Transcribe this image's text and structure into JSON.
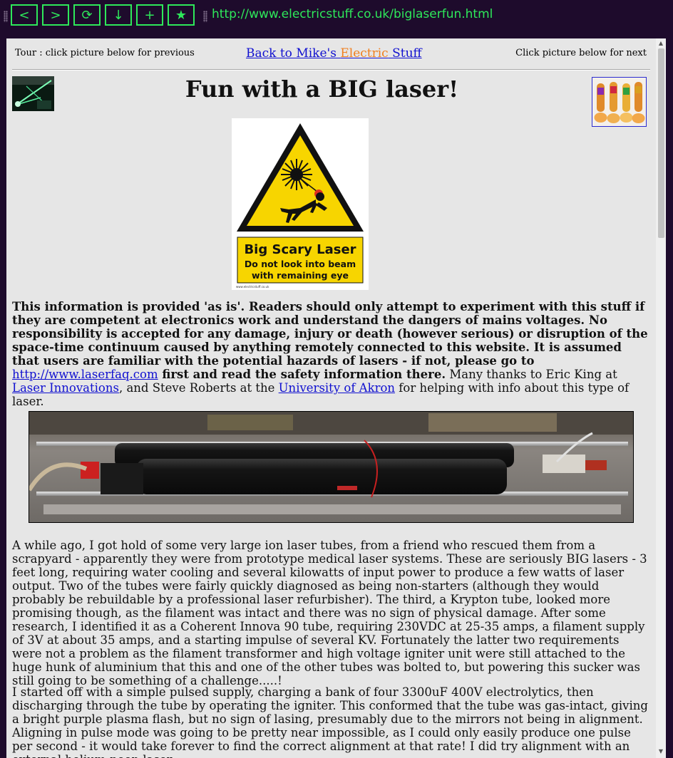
{
  "browser": {
    "nav_buttons": {
      "back": "<",
      "forward": ">",
      "reload": "⟳",
      "download": "↓",
      "new_tab": "+",
      "bookmark": "★"
    },
    "url": "http://www.electricstuff.co.uk/biglaserfun.html"
  },
  "page": {
    "tour_prev": "Tour : click picture below for previous",
    "back_link": {
      "part1": "Back to Mike's ",
      "part2": "Electric",
      "part3": " Stuff"
    },
    "tour_next": "Click picture below for next",
    "title": "Fun with a BIG laser!",
    "sign": {
      "line1": "Big Scary Laser",
      "line2": "Do not look into beam",
      "line3": "with remaining eye",
      "small": "www.electricstuff.co.uk"
    },
    "disclaimer": {
      "bold": "This information is provided 'as is'. Readers should only attempt to experiment with this stuff if they are competent at electronics work and understand the dangers of mains voltages. No responsibility is accepted for any damage, injury or death (however serious) or disruption of the space-time continuum caused by anything remotely connected to this website. It is assumed that users are familiar with the potential hazards of lasers - if not, please go to ",
      "laserfaq_link": "http://www.laserfaq.com",
      "bold2": " first and read the safety information there.",
      "thanks1": " Many thanks to Eric King at ",
      "laser_innovations_link": "Laser Innovations",
      "thanks2": ", and Steve Roberts at the ",
      "akron_link": "University of Akron",
      "thanks3": " for helping with info about this type of laser."
    },
    "paragraph1": "A while ago, I got hold of some very large ion laser tubes, from a friend who rescued them from a scrapyard - apparently they were from prototype medical laser systems. These are seriously BIG lasers - 3 feet long, requiring water cooling and several kilowatts of input power to produce a few watts of laser output. Two of the tubes were fairly quickly diagnosed as being non-starters (although they would probably be rebuildable by a professional laser refurbisher). The third, a Krypton tube, looked more promising though, as the filament was intact and there was no sign of physical damage. After some research, I identified it as a Coherent Innova 90 tube, requiring 230VDC at 25-35 amps, a filament supply of 3V at about 35 amps, and a starting impulse of several KV.  Fortunately the latter two requirements were not a problem as the filament transformer and high voltage igniter unit were still attached to the huge hunk of aluminium that this and one of the other tubes was bolted to, but powering this sucker was still going to be something of a challenge.....!",
    "paragraph2": "I started off with a simple pulsed supply, charging a bank of four 3300uF 400V electrolytics, then discharging through the tube by operating the igniter. This conformed that the tube was gas-intact, giving a bright purple plasma flash, but no sign of lasing, presumably due to the mirrors not being in alignment. Aligning in pulse mode was going to be pretty near impossible, as I could only easily produce one pulse per second - it would take forever to find the correct alignment at that rate! I did try alignment with an external helium-neon laser,"
  },
  "colors": {
    "chrome_bg": "#1e0b2c",
    "chrome_accent": "#2ee85a",
    "page_bg": "#e6e6e6",
    "link": "#1010d0",
    "electric_orange": "#f08020"
  }
}
